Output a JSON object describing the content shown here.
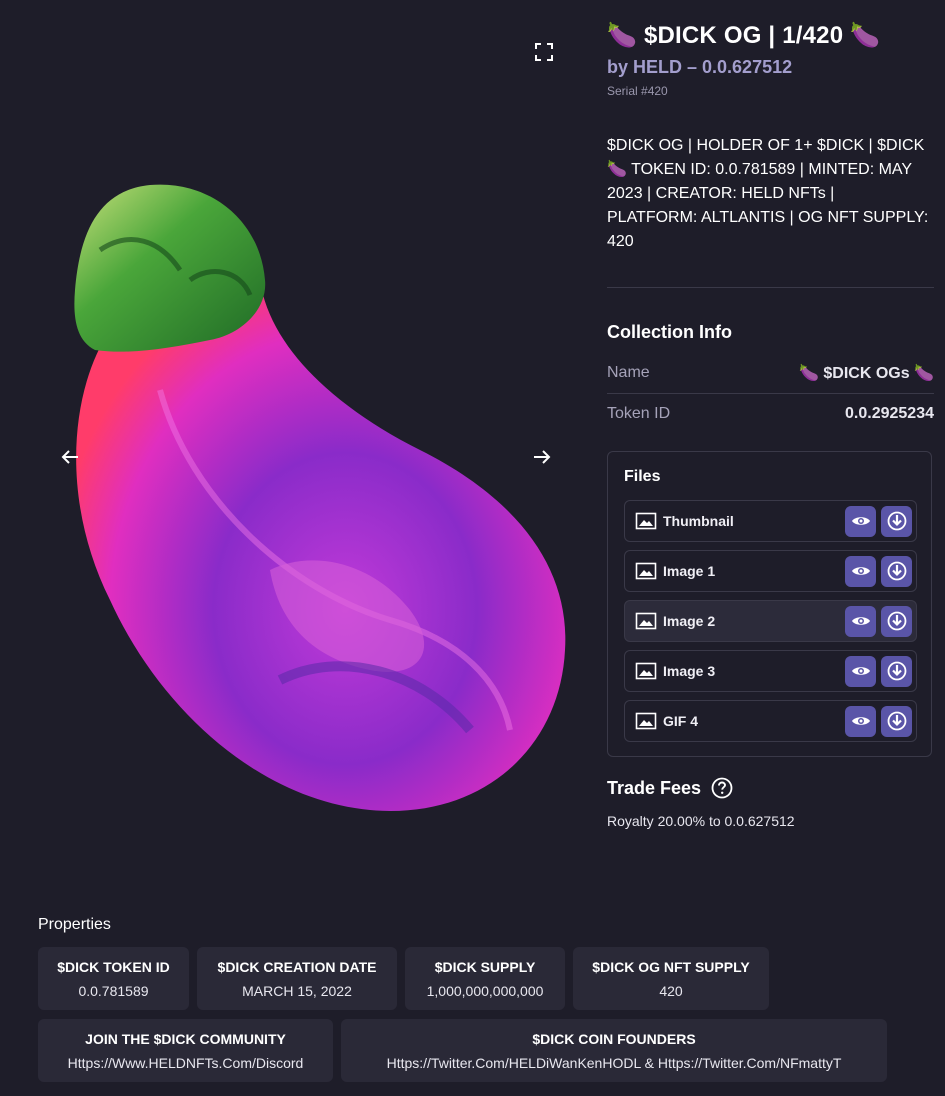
{
  "viewer": {
    "artwork_description": "eggplant-artwork"
  },
  "header": {
    "title": "🍆 $DICK OG | 1/420 🍆",
    "byline": "by HELD – 0.0.627512",
    "serial": "Serial #420"
  },
  "description": "$DICK OG | HOLDER OF 1+ $DICK | $DICK 🍆 TOKEN ID: 0.0.781589 | MINTED: MAY 2023 | CREATOR: HELD NFTs | PLATFORM: ALTLANTIS | OG NFT SUPPLY: 420",
  "collection_info": {
    "heading": "Collection Info",
    "rows": [
      {
        "key": "Name",
        "value": "🍆 $DICK OGs 🍆"
      },
      {
        "key": "Token ID",
        "value": "0.0.2925234"
      }
    ]
  },
  "files": {
    "heading": "Files",
    "items": [
      {
        "label": "Thumbnail",
        "active": false
      },
      {
        "label": "Image 1",
        "active": false
      },
      {
        "label": "Image 2",
        "active": true
      },
      {
        "label": "Image 3",
        "active": false
      },
      {
        "label": "GIF 4",
        "active": false
      }
    ]
  },
  "trade_fees": {
    "heading": "Trade Fees",
    "royalty": "Royalty 20.00% to 0.0.627512"
  },
  "properties": {
    "heading": "Properties",
    "items": [
      {
        "key": "$DICK TOKEN ID",
        "value": "0.0.781589"
      },
      {
        "key": "$DICK CREATION DATE",
        "value": "MARCH 15, 2022"
      },
      {
        "key": "$DICK SUPPLY",
        "value": "1,000,000,000,000"
      },
      {
        "key": "$DICK OG NFT SUPPLY",
        "value": "420"
      },
      {
        "key": "JOIN THE $DICK COMMUNITY",
        "value": "Https://Www.HELDNFTs.Com/Discord"
      },
      {
        "key": "$DICK COIN FOUNDERS",
        "value": "Https://Twitter.Com/HELDiWanKenHODL & Https://Twitter.Com/NFmattyT"
      }
    ]
  },
  "colors": {
    "background": "#1e1d29",
    "accent": "#5a55a8",
    "byline": "#a39ecd",
    "card": "#2a2937"
  }
}
